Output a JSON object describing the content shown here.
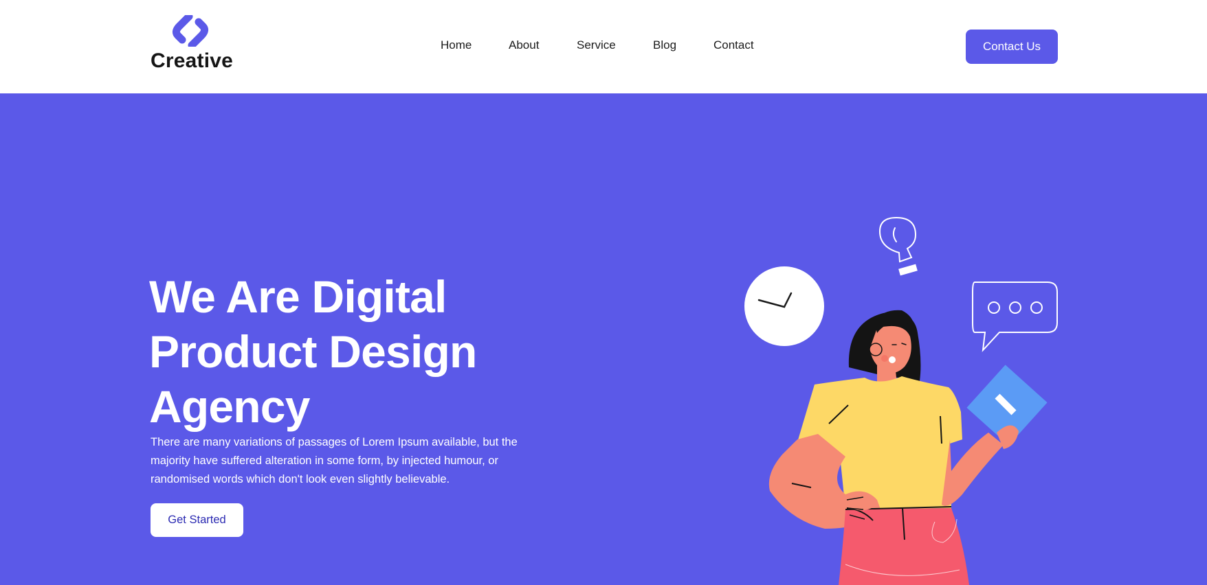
{
  "brand": {
    "name": "Creative",
    "logo_icon": "link-chain-logo",
    "color": "#5b59e8"
  },
  "nav": {
    "items": [
      {
        "label": "Home"
      },
      {
        "label": "About"
      },
      {
        "label": "Service"
      },
      {
        "label": "Blog"
      },
      {
        "label": "Contact"
      }
    ],
    "cta_label": "Contact Us"
  },
  "hero": {
    "title": "We Are Digital Product Design Agency",
    "body": "There are many variations of passages of Lorem Ipsum available, but the majority have suffered alteration in some form, by injected humour, or randomised words which don't look even slightly believable.",
    "button_label": "Get Started"
  },
  "colors": {
    "primary": "#5b59e8",
    "white": "#ffffff",
    "text_dark": "#1b1b1b",
    "button_text": "#2b2ab2"
  },
  "illustration": {
    "icons": [
      "clock-icon",
      "lightbulb-icon",
      "chat-bubble-icon"
    ],
    "figure": "woman-holding-book"
  }
}
